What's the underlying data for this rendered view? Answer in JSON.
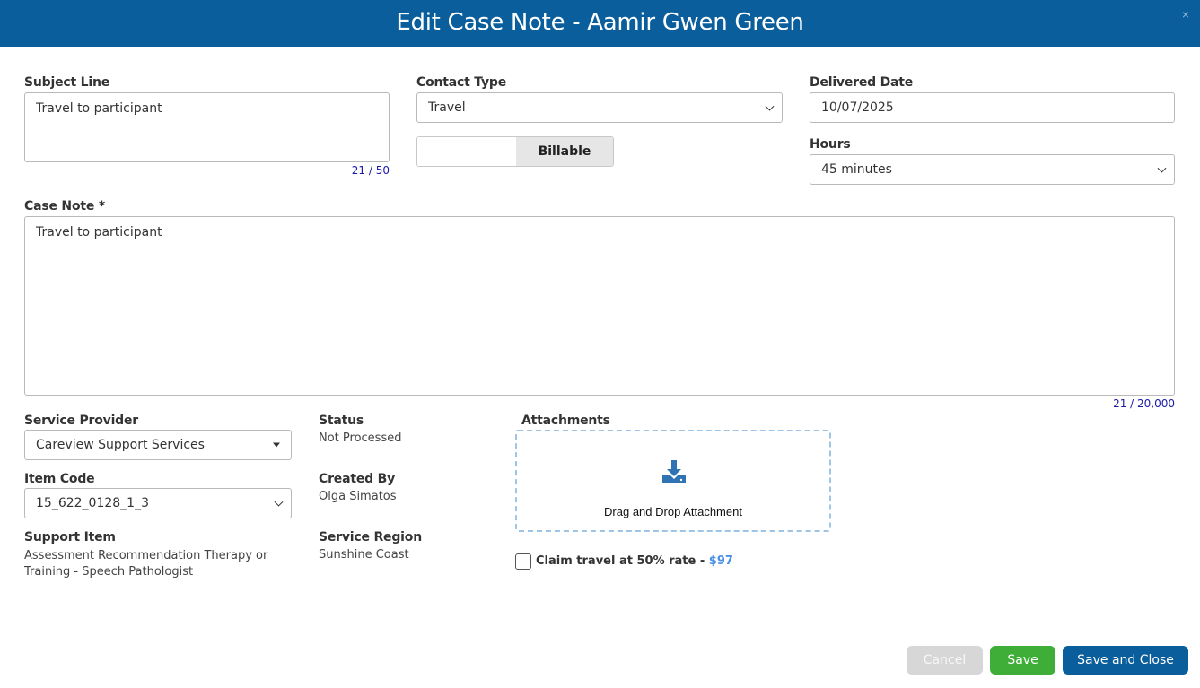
{
  "dialog": {
    "title": "Edit Case Note - Aamir Gwen Green",
    "close_glyph": "×"
  },
  "form": {
    "subject_line": {
      "label": "Subject Line",
      "value": "Travel to participant",
      "counter": "21 / 50"
    },
    "contact_type": {
      "label": "Contact Type",
      "value": "Travel"
    },
    "billable_toggle": {
      "label": "Billable"
    },
    "delivered_date": {
      "label": "Delivered Date",
      "value": "10/07/2025"
    },
    "hours": {
      "label": "Hours",
      "value": "45 minutes"
    },
    "case_note": {
      "label": "Case Note *",
      "value": "Travel to participant",
      "counter": "21 / 20,000"
    },
    "service_provider": {
      "label": "Service Provider",
      "value": "Careview Support Services"
    },
    "item_code": {
      "label": "Item Code",
      "value": "15_622_0128_1_3"
    },
    "support_item": {
      "label": "Support Item",
      "value": "Assessment Recommendation Therapy or Training - Speech Pathologist"
    },
    "status": {
      "label": "Status",
      "value": "Not Processed"
    },
    "created_by": {
      "label": "Created By",
      "value": "Olga Simatos"
    },
    "service_region": {
      "label": "Service Region",
      "value": "Sunshine Coast"
    },
    "attachments": {
      "label": "Attachments",
      "dropzone_text": "Drag and Drop Attachment",
      "icon": "download-tray-icon"
    },
    "claim_travel": {
      "label": "Claim travel at 50% rate - ",
      "amount": "$97",
      "checked": false
    }
  },
  "footer": {
    "cancel_label": "Cancel",
    "save_label": "Save",
    "save_close_label": "Save and Close"
  },
  "colors": {
    "header": "#0a5e9c",
    "save": "#3fae38",
    "save_close": "#0a5e9c",
    "cancel_disabled": "#d7d7d7",
    "counter": "#1a1aa8",
    "amount": "#4a90e2"
  }
}
